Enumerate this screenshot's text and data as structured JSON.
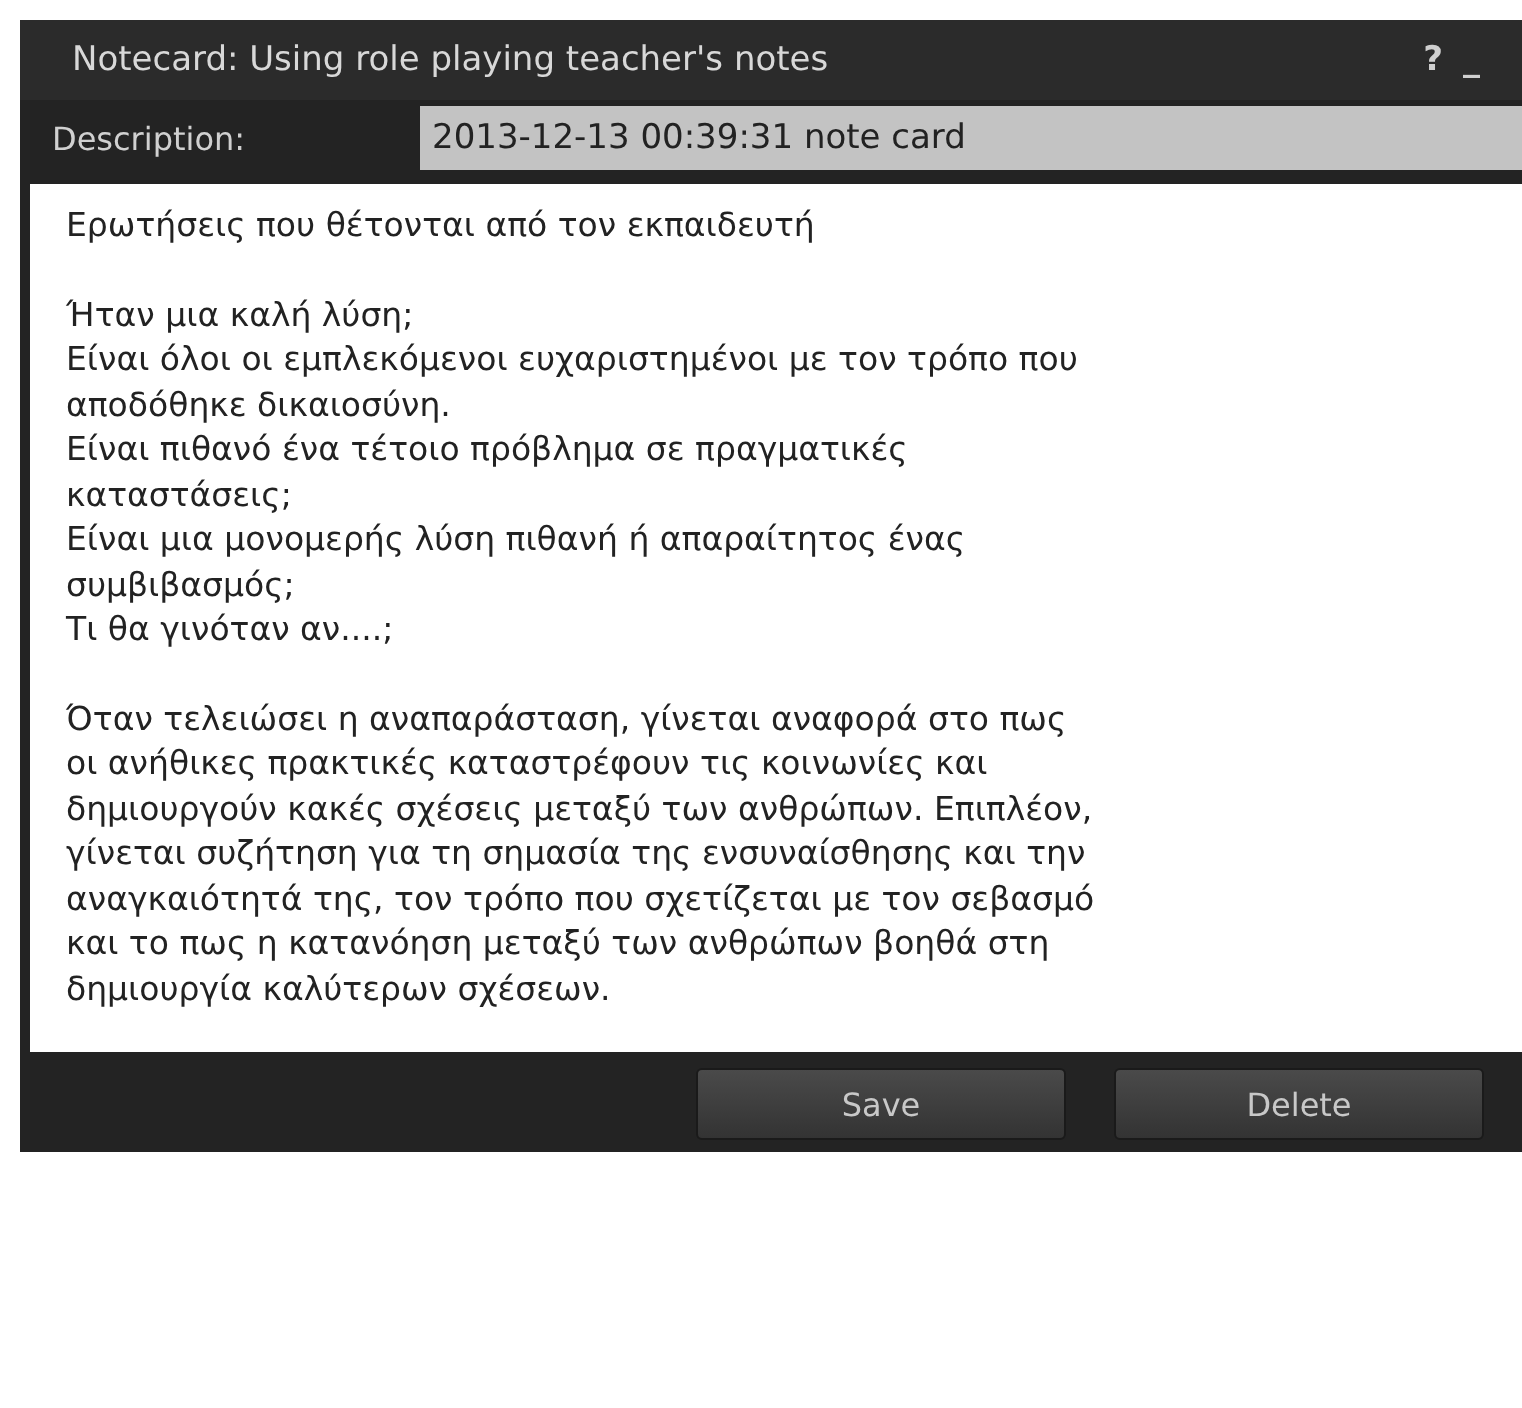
{
  "window": {
    "title": "Notecard: Using role playing teacher's notes",
    "title_buttons": [
      "?",
      "_"
    ]
  },
  "description": {
    "label": "Description:",
    "value": "2013-12-13 00:39:31 note card"
  },
  "notecard_text": [
    [
      "Ερωτήσεις που θέτονται από τον εκπαιδευτή"
    ],
    [
      "Ήταν μια καλή λύση;",
      "Είναι όλοι οι εμπλεκόμενοι ευχαριστημένοι με τον τρόπο που",
      "αποδόθηκε δικαιοσύνη.",
      "Είναι πιθανό ένα τέτοιο πρόβλημα σε πραγματικές",
      "καταστάσεις;",
      "Είναι μια μονομερής λύση πιθανή ή απαραίτητος ένας",
      "συμβιβασμός;",
      "Τι θα γινόταν αν....;"
    ],
    [
      "Όταν τελειώσει η αναπαράσταση, γίνεται αναφορά στο πως",
      "οι ανήθικες πρακτικές καταστρέφουν τις κοινωνίες και",
      "δημιουργούν κακές σχέσεις μεταξύ των ανθρώπων. Επιπλέον,",
      "γίνεται συζήτηση για τη σημασία της ενσυναίσθησης και την",
      "αναγκαιότητά της, τον τρόπο που σχετίζεται με τον σεβασμό",
      "και το πως η κατανόηση μεταξύ των ανθρώπων βοηθά στη",
      "δημιουργία καλύτερων σχέσεων."
    ]
  ],
  "buttons": [
    "Save",
    "Delete"
  ]
}
